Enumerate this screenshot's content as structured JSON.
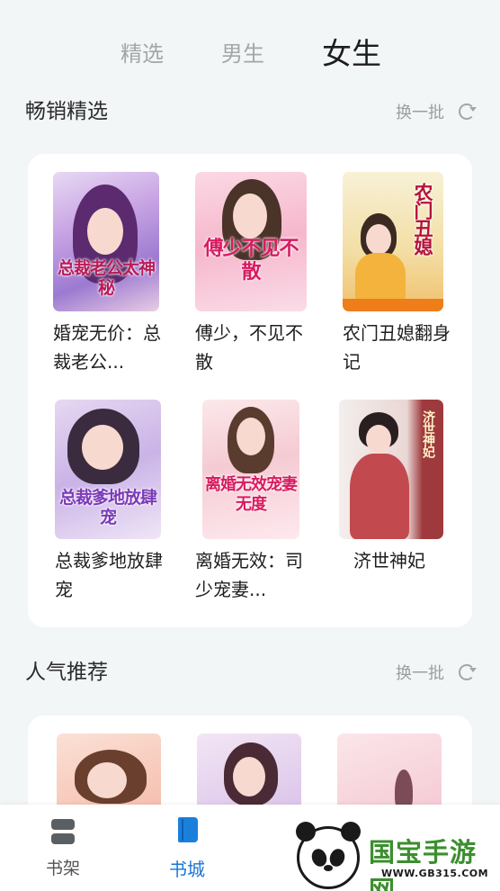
{
  "top_tabs": [
    "精选",
    "男生",
    "女生"
  ],
  "sections": [
    {
      "title": "畅销精选",
      "refresh_label": "换一批",
      "books": [
        {
          "title": "婚宠无价：总裁老公...",
          "cover_text": "总裁老公太神秘"
        },
        {
          "title": "傅少，不见不散",
          "cover_text": "傅少不见不散"
        },
        {
          "title": "农门丑媳翻身记",
          "cover_text": "农门丑媳"
        },
        {
          "title": "总裁爹地放肆宠",
          "cover_text": "总裁爹地放肆宠"
        },
        {
          "title": "离婚无效：司少宠妻...",
          "cover_text": "离婚无效宠妻无度"
        },
        {
          "title": "济世神妃",
          "cover_text": "济世神妃"
        }
      ]
    },
    {
      "title": "人气推荐",
      "refresh_label": "换一批"
    }
  ],
  "bottom_nav": [
    {
      "label": "书架",
      "icon": "bookshelf-icon"
    },
    {
      "label": "书城",
      "icon": "bookstore-icon"
    }
  ],
  "watermark": {
    "text": "国宝手游网",
    "url": "WWW.GB315.COM"
  },
  "colors": {
    "accent": "#1976d2",
    "background": "#f3f6f6",
    "watermark": "#3c8f2e"
  }
}
